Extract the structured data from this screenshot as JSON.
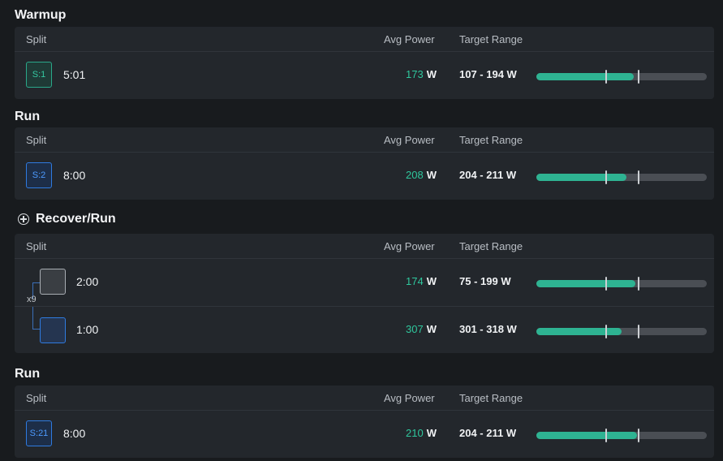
{
  "headers": {
    "split": "Split",
    "avg_power": "Avg Power",
    "target_range": "Target Range"
  },
  "unit": "W",
  "sections": [
    {
      "title": "Warmup",
      "rows": [
        {
          "badge": "S:1",
          "duration": "5:01",
          "avg": "173",
          "target": "107 - 194 W",
          "fill_fraction": 0.57,
          "tick1_fraction": 0.41,
          "tick2_fraction": 0.6
        }
      ]
    },
    {
      "title": "Run",
      "rows": [
        {
          "badge": "S:2",
          "duration": "8:00",
          "avg": "208",
          "target": "204 - 211 W",
          "fill_fraction": 0.53,
          "tick1_fraction": 0.41,
          "tick2_fraction": 0.6
        }
      ]
    },
    {
      "title": "Recover/Run",
      "repeat": "x9",
      "rows": [
        {
          "badge": "",
          "duration": "2:00",
          "avg": "174",
          "target": "75 - 199 W",
          "fill_fraction": 0.58,
          "tick1_fraction": 0.41,
          "tick2_fraction": 0.6
        },
        {
          "badge": "",
          "duration": "1:00",
          "avg": "307",
          "target": "301 - 318 W",
          "fill_fraction": 0.5,
          "tick1_fraction": 0.41,
          "tick2_fraction": 0.6
        }
      ]
    },
    {
      "title": "Run",
      "rows": [
        {
          "badge": "S:21",
          "duration": "8:00",
          "avg": "210",
          "target": "204 - 211 W",
          "fill_fraction": 0.59,
          "tick1_fraction": 0.41,
          "tick2_fraction": 0.6
        }
      ]
    }
  ]
}
